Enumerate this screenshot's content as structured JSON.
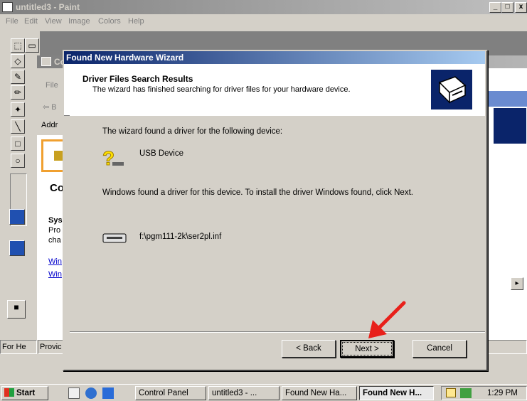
{
  "paint": {
    "title": "untitled3 - Paint",
    "menu": [
      "File",
      "Edit",
      "View",
      "Image",
      "Colors",
      "Help"
    ],
    "status_text": "For He",
    "controls": [
      "_",
      "□",
      "x"
    ]
  },
  "control_panel": {
    "title_fragment": "Co",
    "menu_fragment": "File",
    "back_fragment": "B",
    "address_fragment": "Addr",
    "heading_fragment": "Co",
    "section_title": "Sys",
    "section_lines": [
      "Pro",
      "cha"
    ],
    "links": [
      "Win",
      "Win"
    ],
    "status_fragment": "Provic"
  },
  "wizard": {
    "title": "Found New Hardware Wizard",
    "header_title": "Driver Files Search Results",
    "header_subtitle": "The wizard has finished searching for driver files for your hardware device.",
    "found_text": "The wizard found a driver for the following device:",
    "device_name": "USB Device",
    "install_text": "Windows found a driver for this device. To install the driver Windows found, click Next.",
    "driver_path": "f:\\pgm111-2k\\ser2pl.inf",
    "buttons": {
      "back": "< Back",
      "next": "Next >",
      "cancel": "Cancel"
    }
  },
  "taskbar": {
    "start": "Start",
    "tasks": [
      "Control Panel",
      "untitled3 - ...",
      "Found New Ha...",
      "Found New H..."
    ],
    "clock": "1:29 PM"
  },
  "colors": {
    "wizard_title": "#0a246a",
    "annotation_arrow": "#e8201a"
  }
}
